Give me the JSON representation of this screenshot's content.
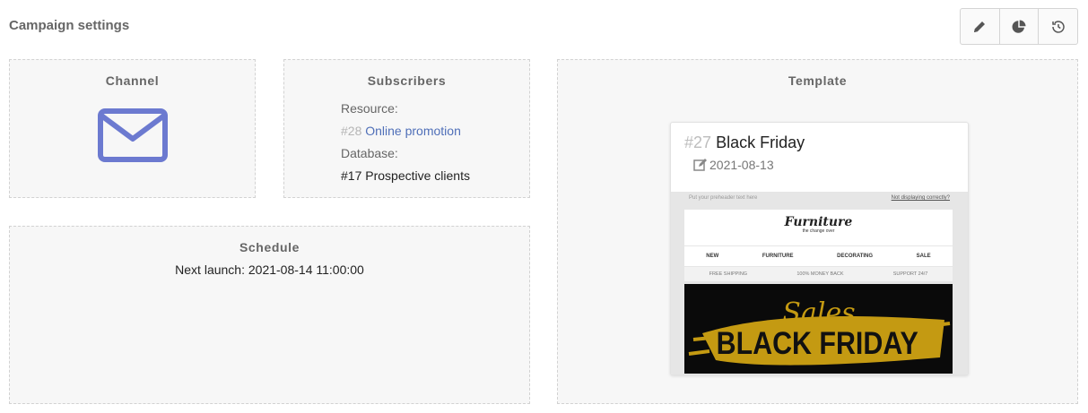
{
  "header": {
    "title": "Campaign settings"
  },
  "toolbar": {
    "buttons": [
      "pencil-icon",
      "pie-chart-icon",
      "history-icon"
    ]
  },
  "channel": {
    "title": "Channel",
    "icon": "envelope-icon",
    "icon_color": "#6c7ad0"
  },
  "subscribers": {
    "title": "Subscribers",
    "resource_label": "Resource:",
    "resource_num": "#28",
    "resource_link": "Online promotion",
    "database_label": "Database:",
    "database_value": "#17 Prospective clients"
  },
  "schedule": {
    "title": "Schedule",
    "next_launch": "Next launch: 2021-08-14 11:00:00"
  },
  "template": {
    "title": "Template",
    "num": "#27",
    "name": "Black Friday",
    "date": "2021-08-13",
    "preview": {
      "preheader": "Put your preheader text here",
      "not_displaying": "Not displaying correctly?",
      "logo": "Furniture",
      "logo_sub": "the change over",
      "nav": [
        "NEW",
        "FURNITURE",
        "DECORATING",
        "SALE"
      ],
      "perks": [
        "FREE SHIPPING",
        "100% MONEY BACK",
        "SUPPORT 24/7"
      ],
      "banner_script": "Sales",
      "banner_text": "BLACK FRIDAY"
    }
  }
}
